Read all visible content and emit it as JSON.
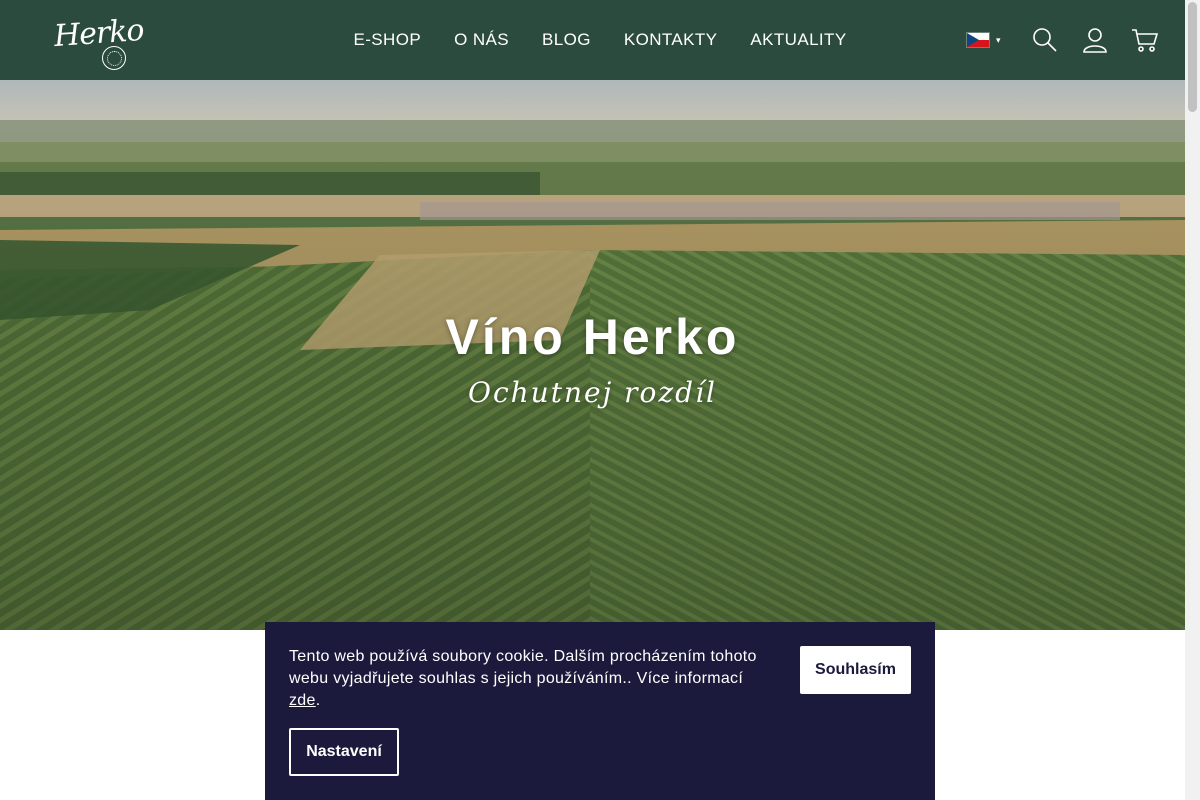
{
  "header": {
    "logo_text": "Herko",
    "nav": [
      {
        "label": "E-SHOP"
      },
      {
        "label": "O NÁS"
      },
      {
        "label": "BLOG"
      },
      {
        "label": "KONTAKTY"
      },
      {
        "label": "AKTUALITY"
      }
    ],
    "language": {
      "icon": "czech-flag-icon",
      "caret": "▾"
    },
    "icons": [
      "search-icon",
      "user-icon",
      "cart-icon"
    ],
    "colors": {
      "background": "#2c4b3f",
      "text": "#ffffff"
    }
  },
  "hero": {
    "title": "Víno Herko",
    "subtitle": "Ochutnej rozdíl"
  },
  "cookie_banner": {
    "text": "Tento web používá soubory cookie. Dalším procházením tohoto webu vyjadřujete souhlas s jejich používáním.. Více informací",
    "link_label": "zde",
    "link_suffix": ".",
    "agree_label": "Souhlasím",
    "settings_label": "Nastavení",
    "colors": {
      "background": "#1c1a3c",
      "button": "#ffffff"
    }
  }
}
